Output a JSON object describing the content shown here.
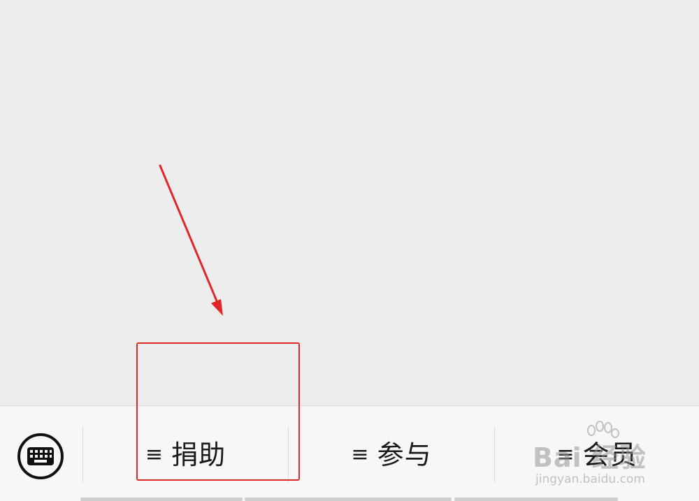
{
  "menu": {
    "items": [
      {
        "glyph": "≡",
        "label": "捐助"
      },
      {
        "glyph": "≡",
        "label": "参与"
      },
      {
        "glyph": "≡",
        "label": "会员"
      }
    ]
  },
  "icons": {
    "keyboard": "keyboard-icon",
    "menu": "menu-lines-icon"
  },
  "annotation": {
    "color": "#e02727"
  },
  "watermark": {
    "main": "Bai 经验",
    "sub": "jingyan.baidu.com"
  }
}
